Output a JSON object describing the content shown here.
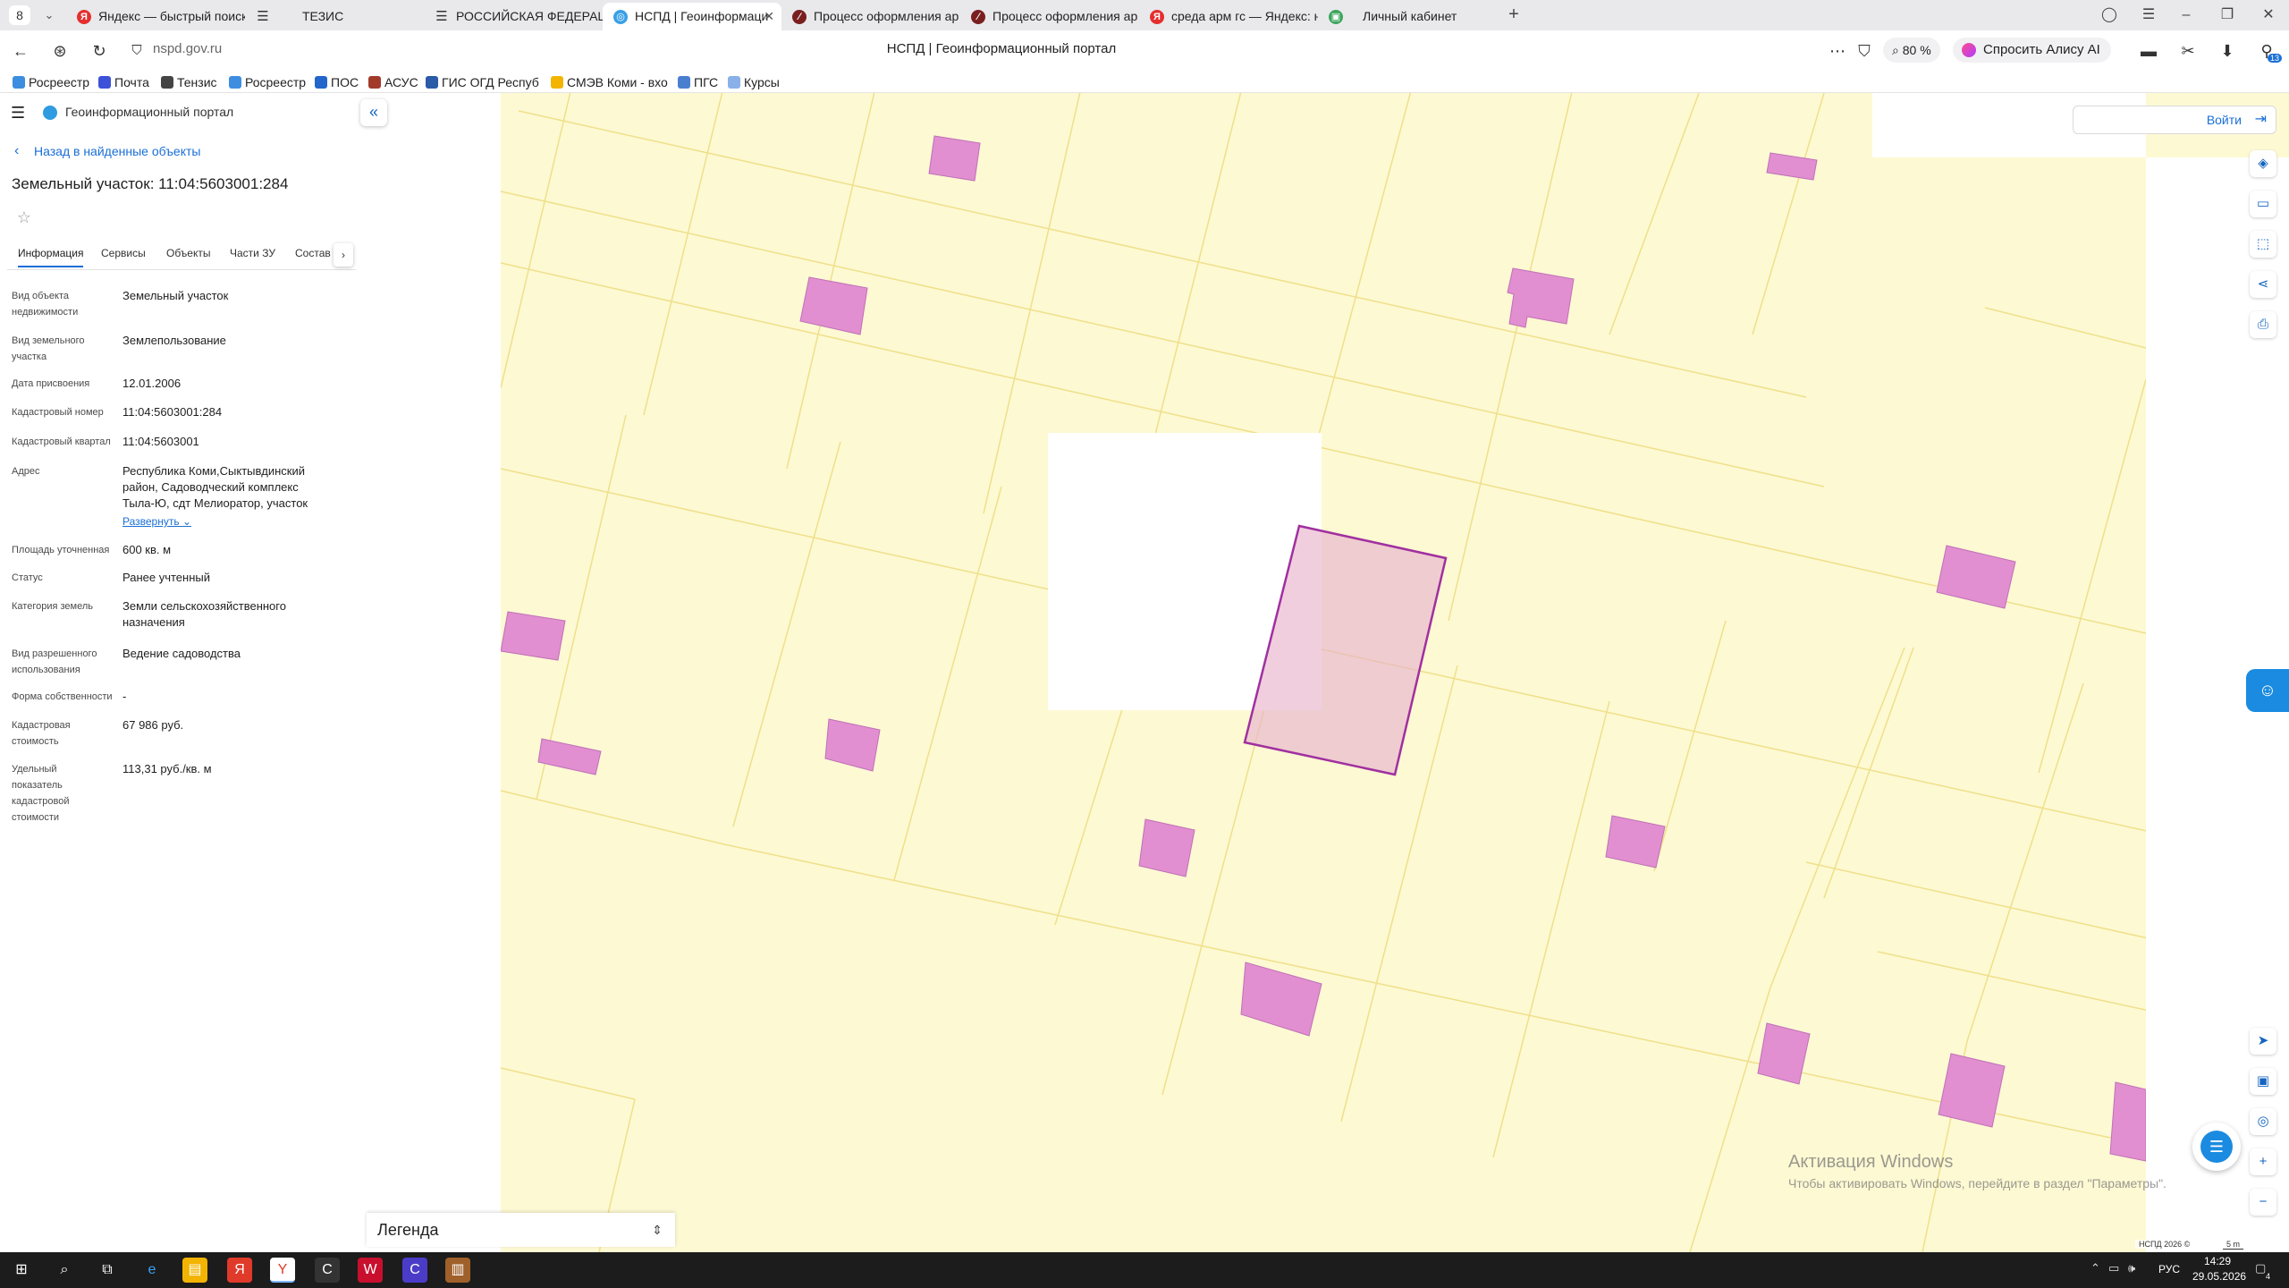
{
  "browser": {
    "tab_count": "8",
    "tabs": [
      {
        "label": "Яндекс — быстрый поиск",
        "icon": "yandex-icon"
      },
      {
        "label": "ТЕЗИС",
        "icon": "menu-icon"
      },
      {
        "label": "РОССИЙСКАЯ ФЕДЕРАЦ",
        "icon": "menu-icon"
      },
      {
        "label": "НСПД | Геоинформаци",
        "icon": "nspd-icon",
        "active": true
      },
      {
        "label": "Процесс оформления ар",
        "icon": "app-icon"
      },
      {
        "label": "Процесс оформления ар",
        "icon": "app-icon"
      },
      {
        "label": "среда арм гс — Яндекс: н",
        "icon": "yandex-icon"
      },
      {
        "label": "Личный кабинет",
        "icon": "cabinet-icon"
      }
    ],
    "url": "nspd.gov.ru",
    "page_title": "НСПД | Геоинформационный портал",
    "zoom": "80 %",
    "alice": "Спросить Алису AI",
    "badge_count": "13",
    "bookmarks": [
      "Росреестр",
      "Почта",
      "Тензис",
      "Росреестр",
      "ПОС",
      "АСУС",
      "ГИС ОГД Респуб",
      "СМЭВ Коми - вхо",
      "ПГС",
      "Курсы"
    ]
  },
  "portal": {
    "name": "Геоинформационный портал",
    "back_link": "Назад в найденные объекты",
    "title": "Земельный участок: 11:04:5603001:284",
    "tabs": [
      "Информация",
      "Сервисы",
      "Объекты",
      "Части ЗУ",
      "Состав"
    ],
    "expand_link": "Развернуть",
    "properties": [
      {
        "label": "Вид объекта недвижимости",
        "value": "Земельный участок"
      },
      {
        "label": "Вид земельного участка",
        "value": "Землепользование"
      },
      {
        "label": "Дата присвоения",
        "value": "12.01.2006"
      },
      {
        "label": "Кадастровый номер",
        "value": "11:04:5603001:284"
      },
      {
        "label": "Кадастровый квартал",
        "value": "11:04:5603001"
      },
      {
        "label": "Адрес",
        "value": "Республика Коми,Сыктывдинский район, Садоводческий комплекс Тыла-Ю, сдт Мелиоратор, участок"
      },
      {
        "label": "Площадь уточненная",
        "value": "600 кв. м"
      },
      {
        "label": "Статус",
        "value": "Ранее учтенный"
      },
      {
        "label": "Категория земель",
        "value": "Земли сельскохозяйственного назначения"
      },
      {
        "label": "Вид разрешенного использования",
        "value": "Ведение садоводства"
      },
      {
        "label": "Форма собственности",
        "value": "-"
      },
      {
        "label": "Кадастровая стоимость",
        "value": "67 986 руб."
      },
      {
        "label": "Удельный показатель кадастровой стоимости",
        "value": "113,31 руб./кв. м"
      }
    ],
    "legend": "Легенда"
  },
  "map": {
    "login": "Войти",
    "colors": {
      "background": "#fdf9d3",
      "parcel_line": "#efe08a",
      "building": "#e18fd0",
      "selected_fill": "#f0c8d8",
      "selected_stroke": "#a030a0"
    },
    "tools": [
      "layers-icon",
      "ruler-icon",
      "select-area-icon",
      "share-icon",
      "print-icon"
    ],
    "nav_tools": [
      "locate-icon",
      "minimap-icon",
      "target-icon",
      "zoom-in-icon",
      "zoom-out-icon"
    ],
    "windows_activation_title": "Активация Windows",
    "windows_activation_text": "Чтобы активировать Windows, перейдите в раздел \"Параметры\".",
    "copyright": "НСПД 2026 ©",
    "scale": "5 m"
  },
  "taskbar": {
    "lang": "РУС",
    "time": "14:29",
    "date": "29.05.2026",
    "notifications": "4"
  }
}
